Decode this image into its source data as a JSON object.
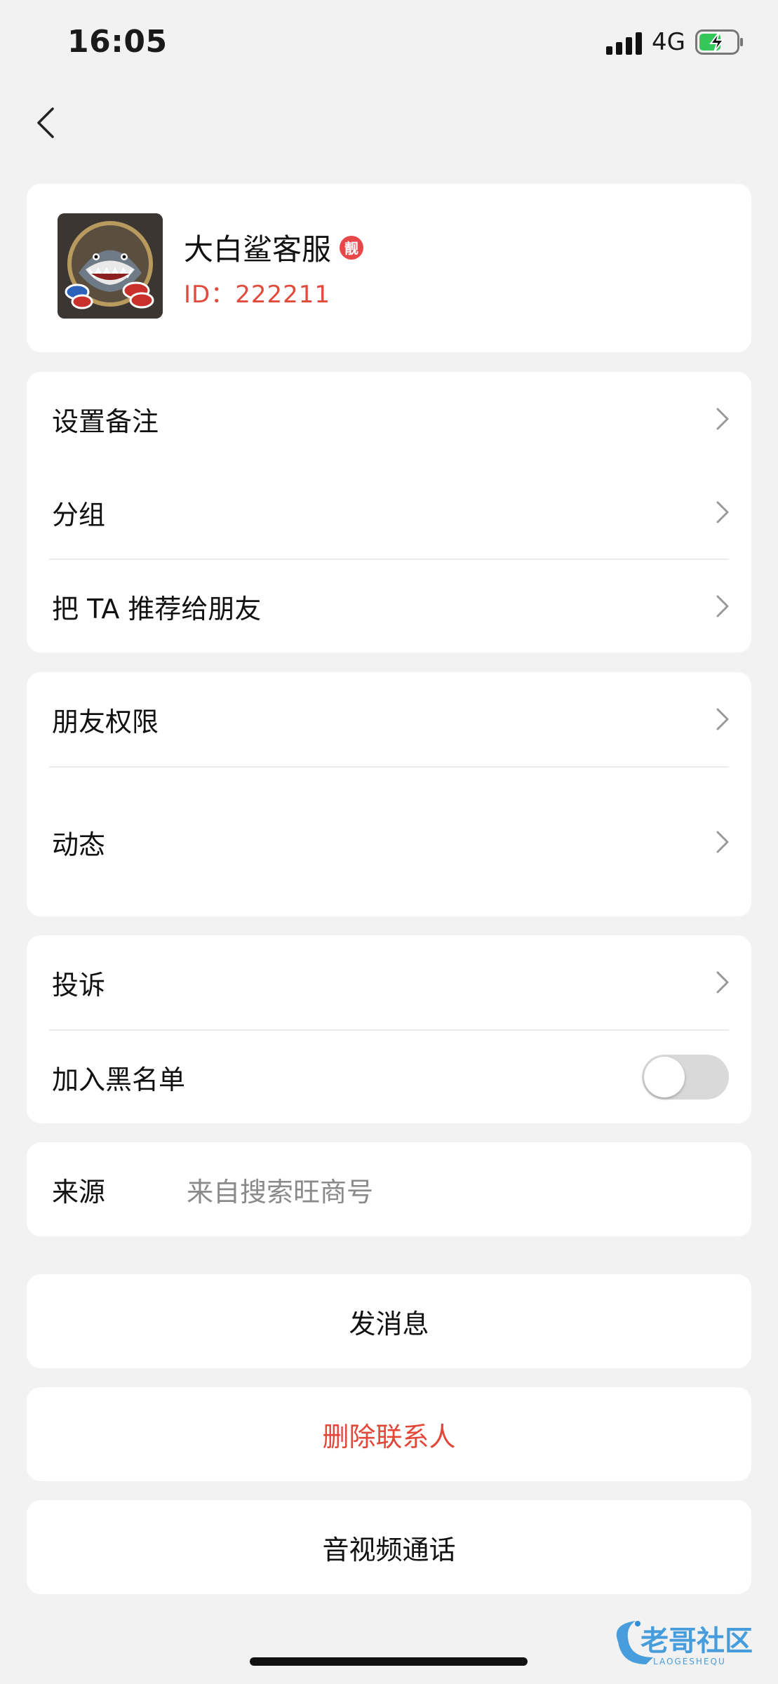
{
  "status_bar": {
    "time": "16:05",
    "network": "4G",
    "battery_charging": true,
    "battery_color": "#34c759"
  },
  "profile": {
    "name": "大白鲨客服",
    "badge": "靓",
    "id_text": "ID：222211",
    "id_color": "#e14b3c"
  },
  "group1": {
    "set_remark": "设置备注",
    "group": "分组",
    "recommend": "把 TA 推荐给朋友"
  },
  "group2": {
    "permissions": "朋友权限",
    "moments": "动态"
  },
  "group3": {
    "complaint": "投诉",
    "blacklist": "加入黑名单",
    "blacklist_on": false
  },
  "source": {
    "label": "来源",
    "value": "来自搜索旺商号"
  },
  "actions": {
    "send_message": "发消息",
    "delete_contact": "删除联系人",
    "av_call": "音视频通话"
  },
  "watermark": {
    "text": "老哥社区",
    "subtext": "LAOGESHEQU"
  }
}
